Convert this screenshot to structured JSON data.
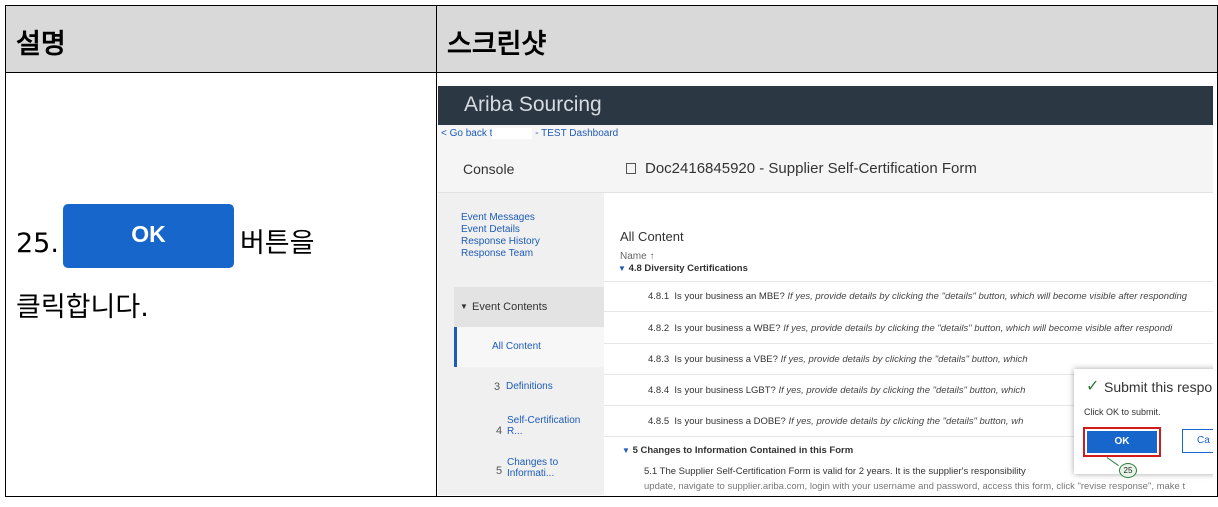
{
  "header": {
    "col1": "설명",
    "col2": "스크린샷"
  },
  "step": {
    "number": "25.",
    "button_label": "OK",
    "text_after": "버튼을",
    "text_line2": "클릭합니다."
  },
  "screenshot": {
    "brand": "Ariba Sourcing",
    "back_link_prefix": "< Go back t",
    "back_link_suffix": "- TEST Dashboard",
    "console": "Console",
    "doc_title": "Doc2416845920 - Supplier Self-Certification Form",
    "nav_links": [
      "Event Messages",
      "Event Details",
      "Response History",
      "Response Team"
    ],
    "event_contents": "Event Contents",
    "nav_items": [
      {
        "num": "",
        "label": "All Content"
      },
      {
        "num": "3",
        "label": "Definitions"
      },
      {
        "num": "4",
        "label": "Self-Certification R..."
      },
      {
        "num": "5",
        "label": "Changes to Informati..."
      }
    ],
    "all_content": "All Content",
    "name_col": "Name ↑",
    "section_48": "4.8  Diversity Certifications",
    "rows": [
      {
        "num": "4.8.1",
        "q": "Is your business an MBE?",
        "hint": "If yes, provide details by clicking the \"details\" button, which will become visible after responding"
      },
      {
        "num": "4.8.2",
        "q": "Is your business a WBE?",
        "hint": "If yes, provide details by clicking the \"details\" button, which will become visible after respondi"
      },
      {
        "num": "4.8.3",
        "q": "Is your business a VBE?",
        "hint": "If yes, provide details by clicking the \"details\" button, which"
      },
      {
        "num": "4.8.4",
        "q": "Is your business LGBT?",
        "hint": "If yes, provide details by clicking the \"details\" button, which"
      },
      {
        "num": "4.8.5",
        "q": "Is your business a DOBE?",
        "hint": "If yes, provide details by clicking the \"details\" button, wh"
      }
    ],
    "section_5": "5  Changes to Information Contained in this Form",
    "row_51": "5.1  The Supplier Self-Certification Form is valid for 2 years. It is the supplier's responsibility",
    "row_51_cont": "update, navigate to supplier.ariba.com, login with your username and password, access this form, click \"revise response\", make t",
    "popup": {
      "title": "Submit this respo",
      "subtitle": "Click OK to submit.",
      "ok": "OK",
      "cancel": "Ca",
      "badge": "25"
    }
  }
}
